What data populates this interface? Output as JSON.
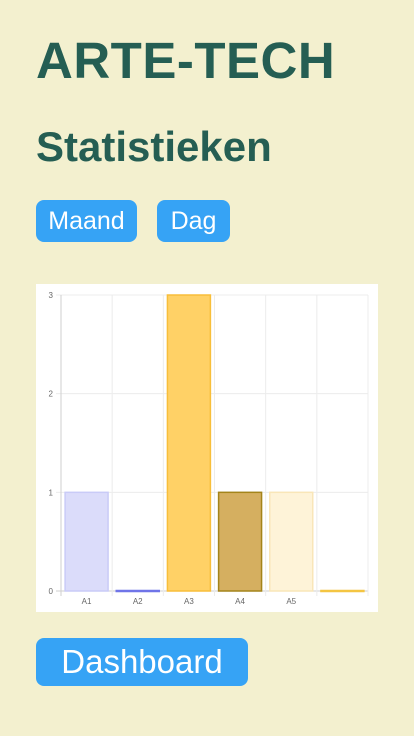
{
  "header": {
    "brand": "ARTE-TECH",
    "title": "Statistieken"
  },
  "filters": {
    "month_label": "Maand",
    "day_label": "Dag"
  },
  "footer": {
    "dashboard_label": "Dashboard"
  },
  "chart_data": {
    "type": "bar",
    "title": "",
    "xlabel": "",
    "ylabel": "",
    "categories": [
      "A1",
      "A2",
      "A3",
      "A4",
      "A5",
      ""
    ],
    "values": [
      1,
      0,
      3,
      1,
      1,
      0
    ],
    "ylim": [
      0,
      3
    ],
    "yticks": [
      0,
      1,
      2,
      3
    ],
    "grid": true,
    "legend": "none",
    "bar_fill_colors": [
      "rgba(175,178,245,0.45)",
      "rgba(200,200,245,0.45)",
      "#ffd166",
      "#d5af60",
      "#fef3d8",
      "#fff7e0"
    ],
    "bar_border_colors": [
      "#c9cbf7",
      "#6f74e8",
      "#f8be3a",
      "#a4841a",
      "#f9e6b8",
      "#f4c542"
    ]
  }
}
